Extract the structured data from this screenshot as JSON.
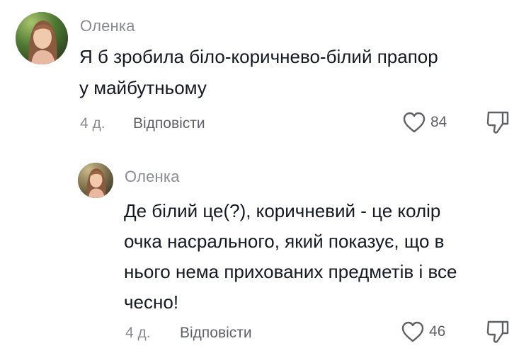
{
  "comments": [
    {
      "author": "Оленка",
      "text_lines": [
        "Я б зробила біло-коричнево-білий прапор",
        "у майбутньому"
      ],
      "time": "4 д.",
      "reply_label": "Відповісти",
      "likes": "84",
      "avatar_icon": "avatar-photo",
      "like_icon": "heart-outline-icon",
      "dislike_icon": "thumbs-down-icon"
    },
    {
      "author": "Оленка",
      "text_lines": [
        "Де білий це(?), коричневий - це колір",
        "очка насрального, який показує, що в",
        "нього нема прихованих предметів і все",
        "чесно!"
      ],
      "time": "4 д.",
      "reply_label": "Відповісти",
      "likes": "46",
      "avatar_icon": "avatar-photo",
      "like_icon": "heart-outline-icon",
      "dislike_icon": "thumbs-down-icon"
    }
  ]
}
